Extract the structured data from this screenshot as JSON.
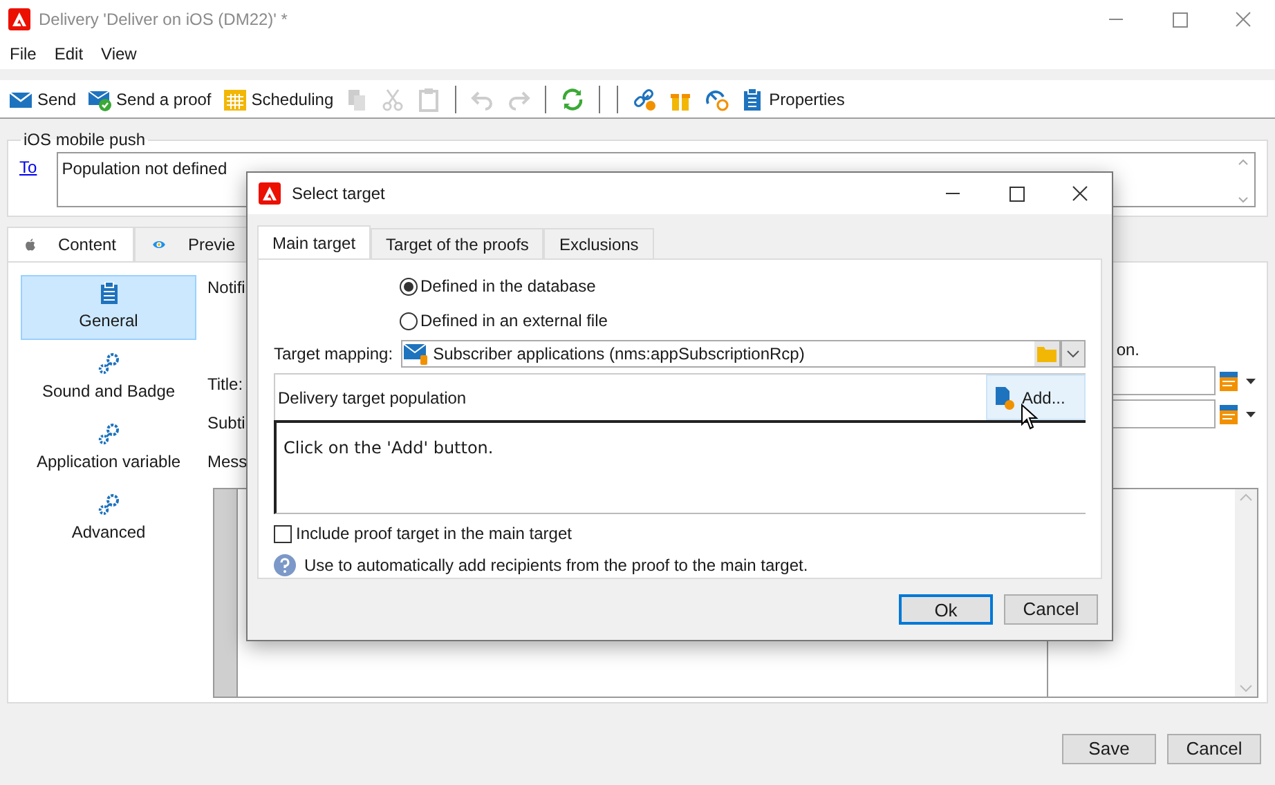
{
  "window": {
    "title": "Delivery 'Deliver on iOS (DM22)' *"
  },
  "menu": [
    "File",
    "Edit",
    "View"
  ],
  "toolbar": [
    {
      "kind": "send",
      "label": "Send",
      "disabled": false
    },
    {
      "kind": "proof",
      "label": "Send a proof",
      "disabled": false
    },
    {
      "kind": "calendar",
      "label": "Scheduling",
      "disabled": false
    },
    {
      "kind": "copy",
      "disabled": true
    },
    {
      "kind": "cut",
      "disabled": true
    },
    {
      "kind": "paste",
      "disabled": true
    },
    {
      "kind": "sep"
    },
    {
      "kind": "undo",
      "disabled": true
    },
    {
      "kind": "redo",
      "disabled": true
    },
    {
      "kind": "sep"
    },
    {
      "kind": "refresh",
      "disabled": false
    },
    {
      "kind": "sep"
    },
    {
      "kind": "sep"
    },
    {
      "kind": "link",
      "disabled": false
    },
    {
      "kind": "gift",
      "disabled": false
    },
    {
      "kind": "gauge",
      "disabled": false
    },
    {
      "kind": "clipboard",
      "label": "Properties",
      "disabled": false
    }
  ],
  "group": {
    "title": "iOS mobile push",
    "to_link": "To",
    "to_value": "Population not defined"
  },
  "tabs": [
    {
      "kind": "apple",
      "label": "Content",
      "selected": true
    },
    {
      "kind": "eye",
      "label": "Previe",
      "selected": false
    }
  ],
  "sidebar": [
    {
      "kind": "clipboard",
      "label": "General",
      "selected": true
    },
    {
      "kind": "gears",
      "label": "Sound and Badge",
      "selected": false
    },
    {
      "kind": "gears",
      "label": "Application variable",
      "selected": false
    },
    {
      "kind": "gears",
      "label": "Advanced",
      "selected": false
    }
  ],
  "form": {
    "heading": "Notifi",
    "labels": [
      "Title:",
      "Subti",
      "Mess"
    ],
    "note": "on."
  },
  "buttons": [
    "Save",
    "Cancel"
  ],
  "dialog": {
    "title": "Select target",
    "tabs": [
      {
        "label": "Main target",
        "selected": true
      },
      {
        "label": "Target of the proofs",
        "selected": false
      },
      {
        "label": "Exclusions",
        "selected": false
      }
    ],
    "radios": [
      {
        "label": "Defined in the database",
        "selected": true
      },
      {
        "label": "Defined in an external file",
        "selected": false
      }
    ],
    "mapping_label": "Target mapping:",
    "mapping_value": "Subscriber applications (nms:appSubscriptionRcp)",
    "population_label": "Delivery target population",
    "add_button": "Add...",
    "hint": "Click on the 'Add' button.",
    "checkbox": {
      "label": "Include proof target in the main target",
      "checked": false
    },
    "help": "Use to automatically add recipients from the proof to the main target.",
    "buttons": [
      {
        "label": "Ok",
        "default": true
      },
      {
        "label": "Cancel",
        "default": false
      }
    ]
  }
}
